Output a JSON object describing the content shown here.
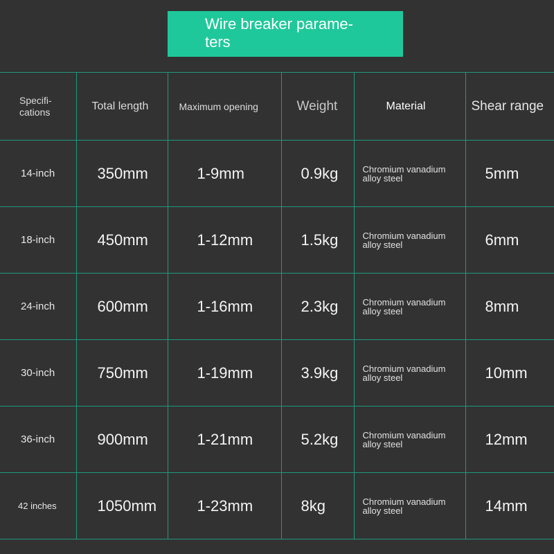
{
  "title": {
    "line1": "Wire breaker parame-",
    "line2": "ters"
  },
  "table": {
    "headers": {
      "spec_line1": "Specifi-",
      "spec_line2": "cations",
      "total_length": "Total length",
      "maximum_opening": "Maximum opening",
      "weight": "Weight",
      "material": "Material",
      "shear_range": "Shear range"
    },
    "rows": [
      {
        "spec": "14-inch",
        "total_length": "350mm",
        "max_opening": "1-9mm",
        "weight": "0.9kg",
        "material_line1": "Chromium vanadium",
        "material_line2": "alloy steel",
        "shear_range": "5mm"
      },
      {
        "spec": "18-inch",
        "total_length": "450mm",
        "max_opening": "1-12mm",
        "weight": "1.5kg",
        "material_line1": "Chromium vanadium",
        "material_line2": "alloy steel",
        "shear_range": "6mm"
      },
      {
        "spec": "24-inch",
        "total_length": "600mm",
        "max_opening": "1-16mm",
        "weight": "2.3kg",
        "material_line1": "Chromium vanadium",
        "material_line2": "alloy steel",
        "shear_range": "8mm"
      },
      {
        "spec": "30-inch",
        "total_length": "750mm",
        "max_opening": "1-19mm",
        "weight": "3.9kg",
        "material_line1": "Chromium vanadium",
        "material_line2": "alloy steel",
        "shear_range": "10mm"
      },
      {
        "spec": "36-inch",
        "total_length": "900mm",
        "max_opening": "1-21mm",
        "weight": "5.2kg",
        "material_line1": "Chromium vanadium",
        "material_line2": "alloy steel",
        "shear_range": "12mm"
      },
      {
        "spec": "42 inches",
        "total_length": "1050mm",
        "max_opening": "1-23mm",
        "weight": "8kg",
        "material_line1": "Chromium vanadium",
        "material_line2": "alloy steel",
        "shear_range": "14mm"
      }
    ]
  },
  "colors": {
    "background": "#323232",
    "title_box": "#1fc89a",
    "grid_line": "#1e9a7c"
  }
}
